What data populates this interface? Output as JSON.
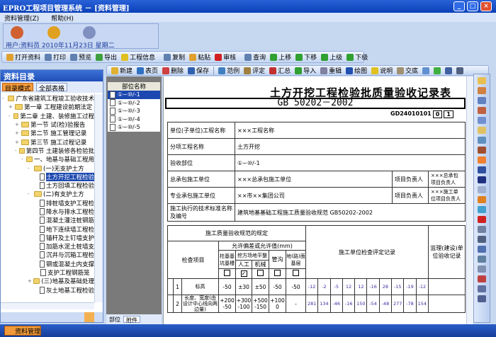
{
  "window": {
    "title": "EPRO工程项目管理系统 － [资料管理]",
    "minimize": "_",
    "maximize": "□",
    "close": "×"
  },
  "menu": [
    "资料管理(Z)",
    "帮助(H)"
  ],
  "info": {
    "user": "用户:资料员",
    "date": "2010年11月23日",
    "weekday": "星期二"
  },
  "toolbar1": [
    "打开资料",
    "打印",
    "预览",
    "导出",
    "工程信息",
    "复制",
    "粘贴",
    "审核",
    "查询",
    "上移",
    "下移",
    "上级",
    "下级"
  ],
  "toolbar2": [
    "新建",
    "表页",
    "删除",
    "保存",
    "范例",
    "评定",
    "汇总",
    "导入",
    "重辑",
    "绘图",
    "说明",
    "交底"
  ],
  "left": {
    "title": "资料目录",
    "mode_active": "目录模式",
    "mode_other": "全部表格",
    "tree": [
      {
        "t": "广东省建筑工程竣工验收技术",
        "l": 0,
        "k": "f",
        "e": "-"
      },
      {
        "t": "第一章 工程建设前期法定",
        "l": 1,
        "k": "f",
        "e": "+"
      },
      {
        "t": "第二章 土建、装修施工过程",
        "l": 1,
        "k": "f",
        "e": "-"
      },
      {
        "t": "第一节 试(检)验报告",
        "l": 2,
        "k": "f",
        "e": "+"
      },
      {
        "t": "第二节 施工管理记录",
        "l": 2,
        "k": "f",
        "e": "+"
      },
      {
        "t": "第三节 施工过程记录",
        "l": 2,
        "k": "f",
        "e": "+"
      },
      {
        "t": "第四节 土建装修各检验批",
        "l": 2,
        "k": "f",
        "e": "-"
      },
      {
        "t": "一、地基与基础工程用",
        "l": 3,
        "k": "f",
        "e": "-"
      },
      {
        "t": "(一)无支护土方",
        "l": 4,
        "k": "f",
        "e": "-"
      },
      {
        "t": "土方开挖工程检验",
        "l": 5,
        "k": "d",
        "sel": true
      },
      {
        "t": "土方回填工程检验",
        "l": 5,
        "k": "d"
      },
      {
        "t": "(二)有支护土方",
        "l": 4,
        "k": "f",
        "e": "-"
      },
      {
        "t": "排桩墙支护工程检",
        "l": 5,
        "k": "d"
      },
      {
        "t": "降水与排水工程检",
        "l": 5,
        "k": "d"
      },
      {
        "t": "混凝土灌注桩钢筋",
        "l": 5,
        "k": "d"
      },
      {
        "t": "地下连续墙工程检",
        "l": 5,
        "k": "d"
      },
      {
        "t": "锚杆及土钉墙支护",
        "l": 5,
        "k": "d"
      },
      {
        "t": "加筋水泥土桩墙支",
        "l": 5,
        "k": "d"
      },
      {
        "t": "沉井与沉箱工程检",
        "l": 5,
        "k": "d"
      },
      {
        "t": "钢或混凝土内支撑",
        "l": 5,
        "k": "d"
      },
      {
        "t": "支护工程钢筋笼",
        "l": 5,
        "k": "d"
      },
      {
        "t": "(三)地基及基础处理",
        "l": 4,
        "k": "f",
        "e": "+"
      },
      {
        "t": "灰土地基工程检验",
        "l": 5,
        "k": "d"
      }
    ]
  },
  "parts": {
    "header": "部位名称",
    "items": [
      "①~⑩/-1",
      "①~⑩/-2",
      "①~⑩/-3",
      "①~⑩/-4",
      "①~⑩/-5"
    ],
    "tabs": [
      "部位",
      "附件"
    ]
  },
  "doc": {
    "title": "土方开挖工程检验批质量验收记录表",
    "standard": "GB 50202－2002",
    "code": "GD24010101",
    "code_boxes": [
      "0",
      "1"
    ],
    "rows": {
      "unit_label": "单位(子单位)工程名称",
      "unit": "×××工程名称",
      "sub_label": "分项工程名称",
      "sub": "土方开挖",
      "part_label": "验收部位",
      "part": "①~⑩/-1",
      "gc_label": "总承包施工单位",
      "gc": "×××总承包施工单位",
      "pm_label": "项目负责人",
      "gc_pm": "×××总承包项目负责人",
      "sc_label": "专业承包施工单位",
      "sc": "××市××集团公司",
      "sc_pm": "×××施工单位项目负责人",
      "std_label": "施工执行的技术标准名称及编号",
      "std": "建筑地基基础工程施工质量验收规范 GB50202-2002"
    },
    "spec_header": "施工质量验收规范的规定",
    "tol_header": "允许偏差或允许值(mm)",
    "item_header": "检查项目",
    "cols": {
      "pile": "柱基基坑基槽",
      "dig": "挖方场地平整",
      "manual": "人工",
      "machine": "机械",
      "trench": "管沟",
      "ground": "地(路)面基层"
    },
    "record_header": "施工单位检查评定记录",
    "super_header": "监理(建设)单位验收记录",
    "checks": [
      false,
      true,
      false,
      false,
      false
    ],
    "items": [
      {
        "no": "1",
        "name": "标高",
        "tol": [
          "-50",
          "±30",
          "±50",
          "-50",
          "-50"
        ],
        "vals": [
          "-12",
          "-2",
          "-5",
          "12",
          "12",
          "-16",
          "28",
          "-15",
          "-19",
          "-12"
        ]
      },
      {
        "no": "2",
        "name": "长度、宽度(由设计中心线向两边量)",
        "tol": [
          "+200 -50",
          "+300 -100",
          "+500 -150",
          "+100 0",
          "-"
        ],
        "vals": [
          "281",
          "134",
          "-46",
          "-16",
          "150",
          "-54",
          "-48",
          "277",
          "-78",
          "154"
        ]
      }
    ]
  },
  "taskbar": {
    "button": "资料管理"
  }
}
